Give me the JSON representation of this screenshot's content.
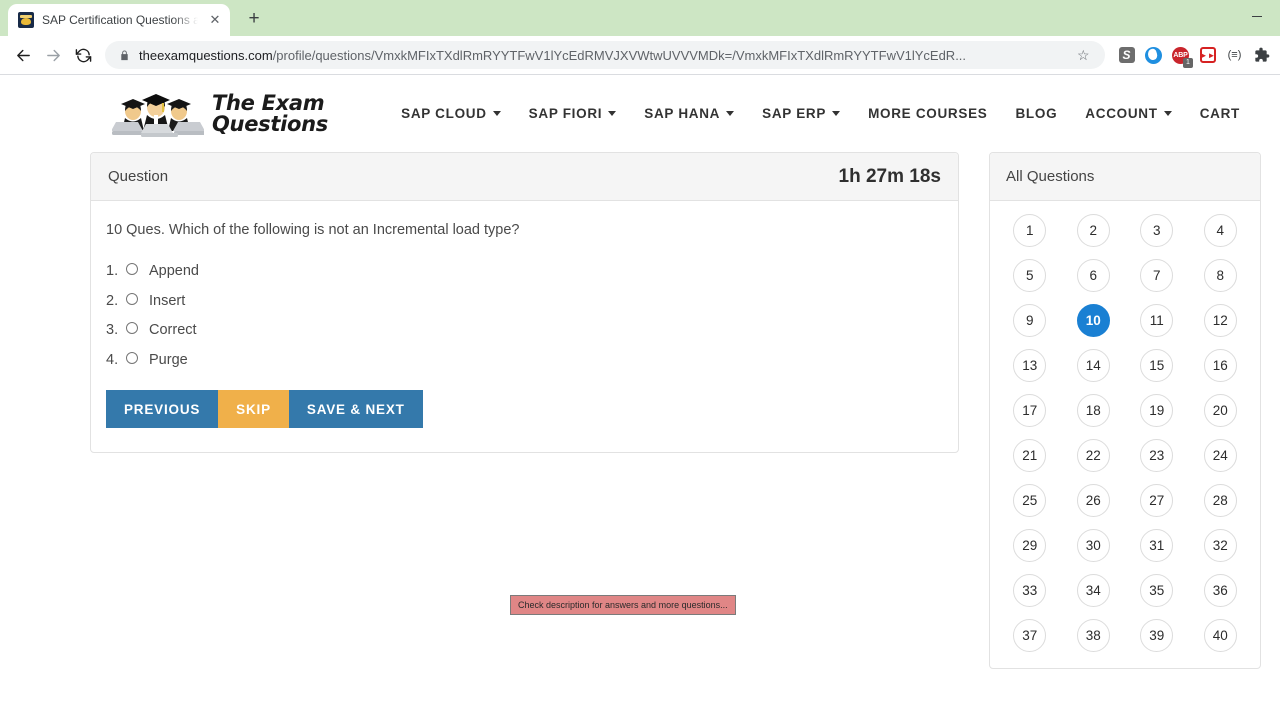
{
  "browser": {
    "tab": {
      "title": "SAP Certification Questions and C",
      "favicon_name": "exam-questions-favicon",
      "close_label": "✕"
    },
    "new_tab_label": "+",
    "window_controls": {
      "minimize_label": "—"
    },
    "nav": {
      "back_label": "←",
      "forward_label": "→",
      "reload_label": "⟳"
    },
    "omnibox": {
      "lock_icon": "lock-icon",
      "url_domain": "theexamquestions.com",
      "url_path": "/profile/questions/VmxkMFIxTXdlRmRYYTFwV1lYcEdRMVJXVWtwUVVVMDk=/VmxkMFIxTXdlRmRYYTFwV1lYcEdR...",
      "star_icon": "☆"
    },
    "extensions": [
      {
        "name": "s-extension-icon",
        "label": "S"
      },
      {
        "name": "globe-extension-icon",
        "label": ""
      },
      {
        "name": "adblock-plus-icon",
        "label": "ABP",
        "badge": "1"
      },
      {
        "name": "fast-forward-extension-icon",
        "label": "▶▶"
      },
      {
        "name": "menu-extension-icon",
        "label": "(≡)"
      },
      {
        "name": "extensions-puzzle-icon",
        "label": ""
      }
    ]
  },
  "site": {
    "logo": {
      "line1": "The Exam",
      "line2": "Questions"
    },
    "nav_items": [
      {
        "label": "SAP CLOUD",
        "has_dropdown": true
      },
      {
        "label": "SAP FIORI",
        "has_dropdown": true
      },
      {
        "label": "SAP HANA",
        "has_dropdown": true
      },
      {
        "label": "SAP ERP",
        "has_dropdown": true
      },
      {
        "label": "MORE COURSES",
        "has_dropdown": false
      },
      {
        "label": "BLOG",
        "has_dropdown": false
      },
      {
        "label": "ACCOUNT",
        "has_dropdown": true
      },
      {
        "label": "CART",
        "has_dropdown": false
      }
    ]
  },
  "question_panel": {
    "header_label": "Question",
    "timer": "1h 27m 18s",
    "question_text": "10 Ques. Which of the following is not an Incremental load type?",
    "options": [
      {
        "num": "1.",
        "label": "Append",
        "selected": false
      },
      {
        "num": "2.",
        "label": "Insert",
        "selected": false
      },
      {
        "num": "3.",
        "label": "Correct",
        "selected": false
      },
      {
        "num": "4.",
        "label": "Purge",
        "selected": false
      }
    ],
    "buttons": [
      {
        "label": "PREVIOUS",
        "color": "#3479ab"
      },
      {
        "label": "SKIP",
        "color": "#f0b04a"
      },
      {
        "label": "SAVE & NEXT",
        "color": "#3479ab"
      }
    ]
  },
  "all_questions": {
    "header_label": "All Questions",
    "active": 10,
    "numbers": [
      1,
      2,
      3,
      4,
      5,
      6,
      7,
      8,
      9,
      10,
      11,
      12,
      13,
      14,
      15,
      16,
      17,
      18,
      19,
      20,
      21,
      22,
      23,
      24,
      25,
      26,
      27,
      28,
      29,
      30,
      31,
      32,
      33,
      34,
      35,
      36,
      37,
      38,
      39,
      40
    ]
  },
  "toast": {
    "text": "Check description for answers and more questions..."
  },
  "colors": {
    "accent_blue": "#1a80d3",
    "button_blue": "#3479ab",
    "button_orange": "#f0b04a",
    "toast_bg": "#e08686",
    "tabstrip_green": "#cde6c4"
  }
}
